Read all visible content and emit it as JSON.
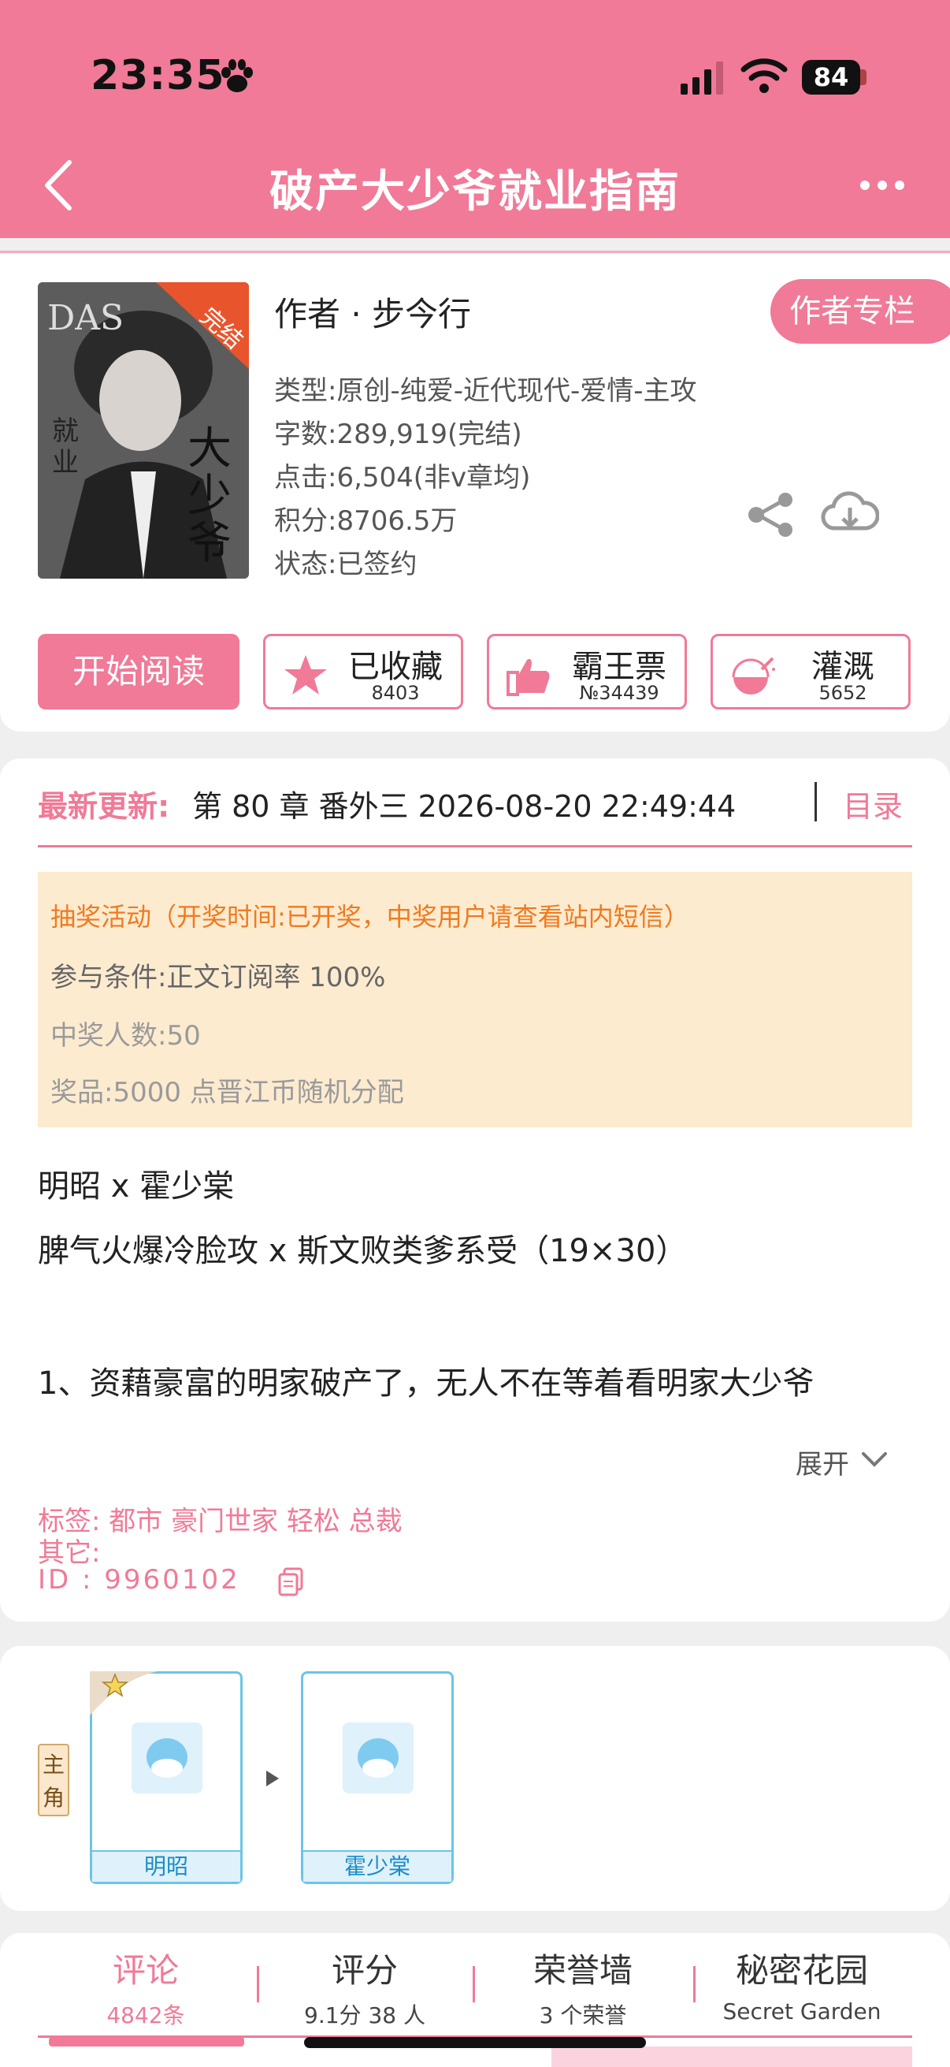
{
  "status_bar": {
    "time": "23:35",
    "battery": "84"
  },
  "header": {
    "title": "破产大少爷就业指南"
  },
  "book": {
    "cover_badge": "完结",
    "author": "作者 · 步今行",
    "author_column": "作者专栏",
    "genre": "类型:原创-纯爱-近代现代-爱情-主攻",
    "words": "字数:289,919(完结)",
    "clicks": "点击:6,504(非v章均)",
    "points": "积分:8706.5万",
    "status": "状态:已签约"
  },
  "actions": {
    "read": "开始阅读",
    "favorite": {
      "label": "已收藏",
      "count": "8403"
    },
    "vote": {
      "label": "霸王票",
      "count": "№34439"
    },
    "water": {
      "label": "灌溉",
      "count": "5652"
    }
  },
  "latest": {
    "label": "最新更新:",
    "text": "第 80 章 番外三 2026-08-20 22:49:44",
    "toc": "目录"
  },
  "lottery": {
    "title": "抽奖活动（开奖时间:已开奖，中奖用户请查看站内短信）",
    "condition": "参与条件:正文订阅率 100%",
    "winners": "中奖人数:50",
    "prize": "奖品:5000 点晋江币随机分配"
  },
  "intro": {
    "line1": "明昭 x 霍少棠",
    "line2": "脾气火爆冷脸攻 x 斯文败类爹系受（19×30）",
    "line3": "1、资藉豪富的明家破产了，无人不在等着看明家大少爷",
    "expand": "展开"
  },
  "tags": {
    "tags_line": "标签: 都市  豪门世家  轻松  总裁",
    "other_line": "其它:",
    "id_line": "ID  :  9960102"
  },
  "characters": {
    "role": "主角",
    "list": [
      {
        "name": "明昭"
      },
      {
        "name": "霍少棠"
      }
    ]
  },
  "tabs": [
    {
      "title": "评论",
      "sub": "4842条"
    },
    {
      "title": "评分",
      "sub": "9.1分 38 人"
    },
    {
      "title": "荣誉墙",
      "sub": "3 个荣誉"
    },
    {
      "title": "秘密花园",
      "sub": "Secret Garden"
    }
  ],
  "colors": {
    "accent": "#f07a97",
    "lottery_bg": "#fdebd0",
    "lottery_title": "#f07a1e",
    "character_border": "#6cc4e8"
  }
}
